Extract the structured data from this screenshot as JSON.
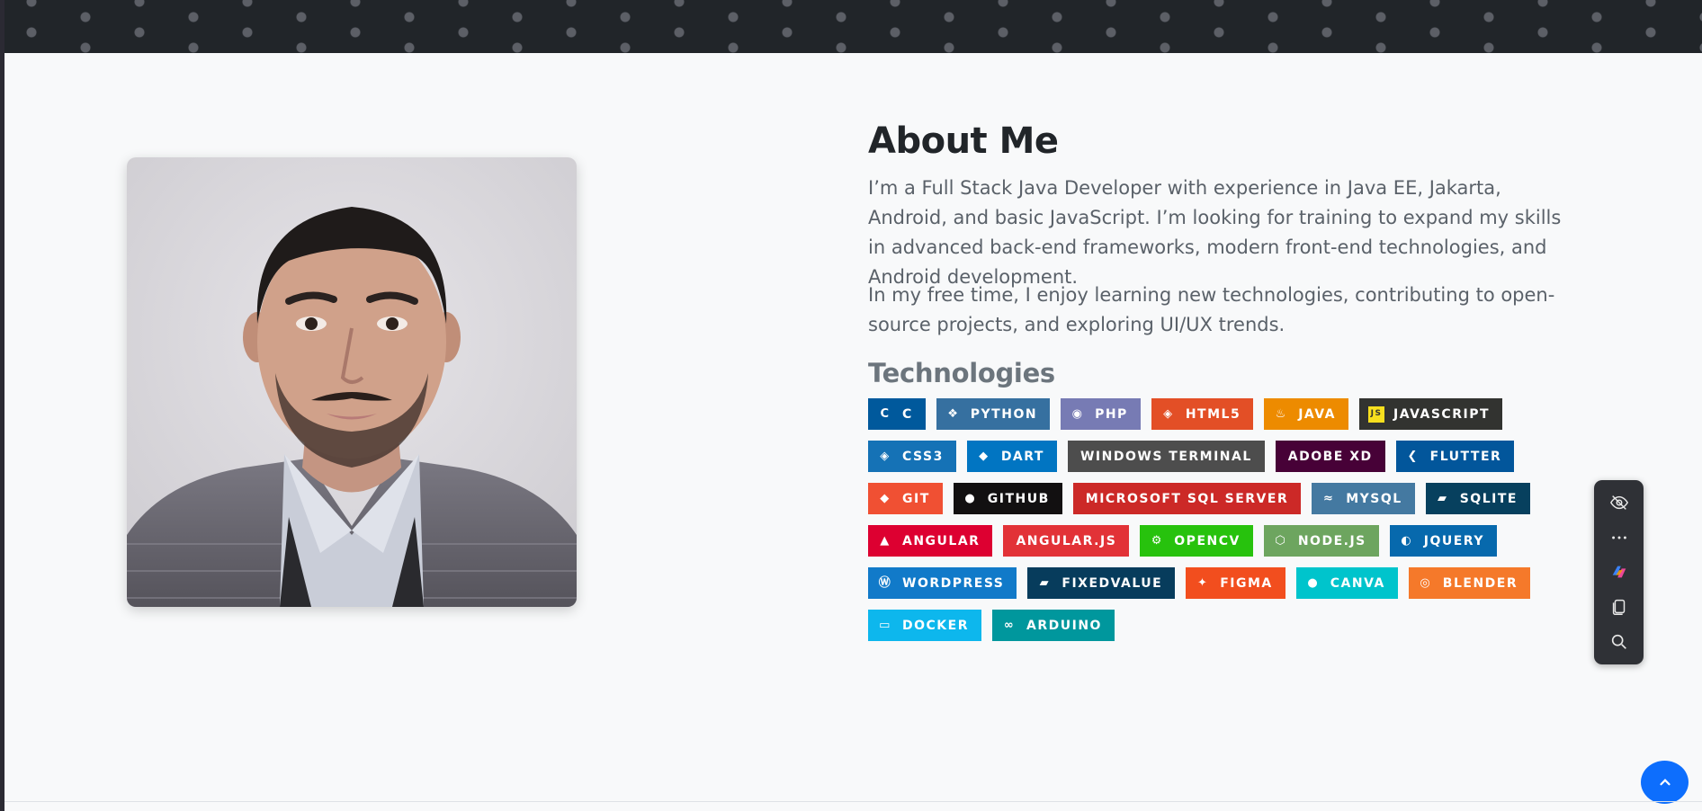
{
  "about": {
    "title": "About Me",
    "paragraph1": "I’m a Full Stack Java Developer with experience in Java EE, Jakarta, Android, and basic JavaScript. I’m looking for training to expand my skills in advanced back-end frameworks, modern front-end technologies, and Android development.",
    "paragraph2": "In my free time, I enjoy learning new technologies, contributing to open-source projects, and exploring UI/UX trends."
  },
  "technologies": {
    "title": "Technologies",
    "badges": [
      {
        "label": "C",
        "color": "#00599c",
        "icon": "c-logo-icon"
      },
      {
        "label": "PYTHON",
        "color": "#3670a0",
        "icon": "python-logo-icon"
      },
      {
        "label": "PHP",
        "color": "#777bb4",
        "icon": "php-logo-icon"
      },
      {
        "label": "HTML5",
        "color": "#e34f26",
        "icon": "html5-logo-icon"
      },
      {
        "label": "JAVA",
        "color": "#ed8b00",
        "icon": "java-logo-icon"
      },
      {
        "label": "JAVASCRIPT",
        "color": "#323330",
        "icon": "javascript-logo-icon"
      },
      {
        "label": "CSS3",
        "color": "#1572b6",
        "icon": "css3-logo-icon"
      },
      {
        "label": "DART",
        "color": "#0175c2",
        "icon": "dart-logo-icon"
      },
      {
        "label": "WINDOWS TERMINAL",
        "color": "#4d4d4d",
        "icon": ""
      },
      {
        "label": "ADOBE XD",
        "color": "#470137",
        "icon": ""
      },
      {
        "label": "FLUTTER",
        "color": "#02569b",
        "icon": "flutter-logo-icon"
      },
      {
        "label": "GIT",
        "color": "#f05033",
        "icon": "git-logo-icon"
      },
      {
        "label": "GITHUB",
        "color": "#121011",
        "icon": "github-logo-icon"
      },
      {
        "label": "MICROSOFT SQL SERVER",
        "color": "#cc2927",
        "icon": ""
      },
      {
        "label": "MYSQL",
        "color": "#4479a1",
        "icon": "mysql-logo-icon"
      },
      {
        "label": "SQLITE",
        "color": "#07405e",
        "icon": "sqlite-logo-icon"
      },
      {
        "label": "ANGULAR",
        "color": "#dd0031",
        "icon": "angular-logo-icon"
      },
      {
        "label": "ANGULAR.JS",
        "color": "#e23237",
        "icon": ""
      },
      {
        "label": "OPENCV",
        "color": "#27c20d",
        "icon": "opencv-logo-icon"
      },
      {
        "label": "NODE.JS",
        "color": "#6da55f",
        "icon": "nodejs-logo-icon"
      },
      {
        "label": "JQUERY",
        "color": "#0769ad",
        "icon": "jquery-logo-icon"
      },
      {
        "label": "WORDPRESS",
        "color": "#117ac9",
        "icon": "wordpress-logo-icon"
      },
      {
        "label": "FIXEDVALUE",
        "color": "#073c5c",
        "icon": "fixedvalue-logo-icon"
      },
      {
        "label": "FIGMA",
        "color": "#f24e1e",
        "icon": "figma-logo-icon"
      },
      {
        "label": "CANVA",
        "color": "#00c4cc",
        "icon": "canva-logo-icon"
      },
      {
        "label": "BLENDER",
        "color": "#f5792a",
        "icon": "blender-logo-icon"
      },
      {
        "label": "DOCKER",
        "color": "#0db7ed",
        "icon": "docker-logo-icon"
      },
      {
        "label": "ARDUINO",
        "color": "#00979d",
        "icon": "arduino-logo-icon"
      }
    ]
  },
  "toolbar": {
    "buttons": [
      "hide-icon",
      "more-icon",
      "copilot-icon",
      "copy-icon",
      "search-icon"
    ]
  },
  "scroll_top": {
    "icon": "chevron-up-icon"
  }
}
